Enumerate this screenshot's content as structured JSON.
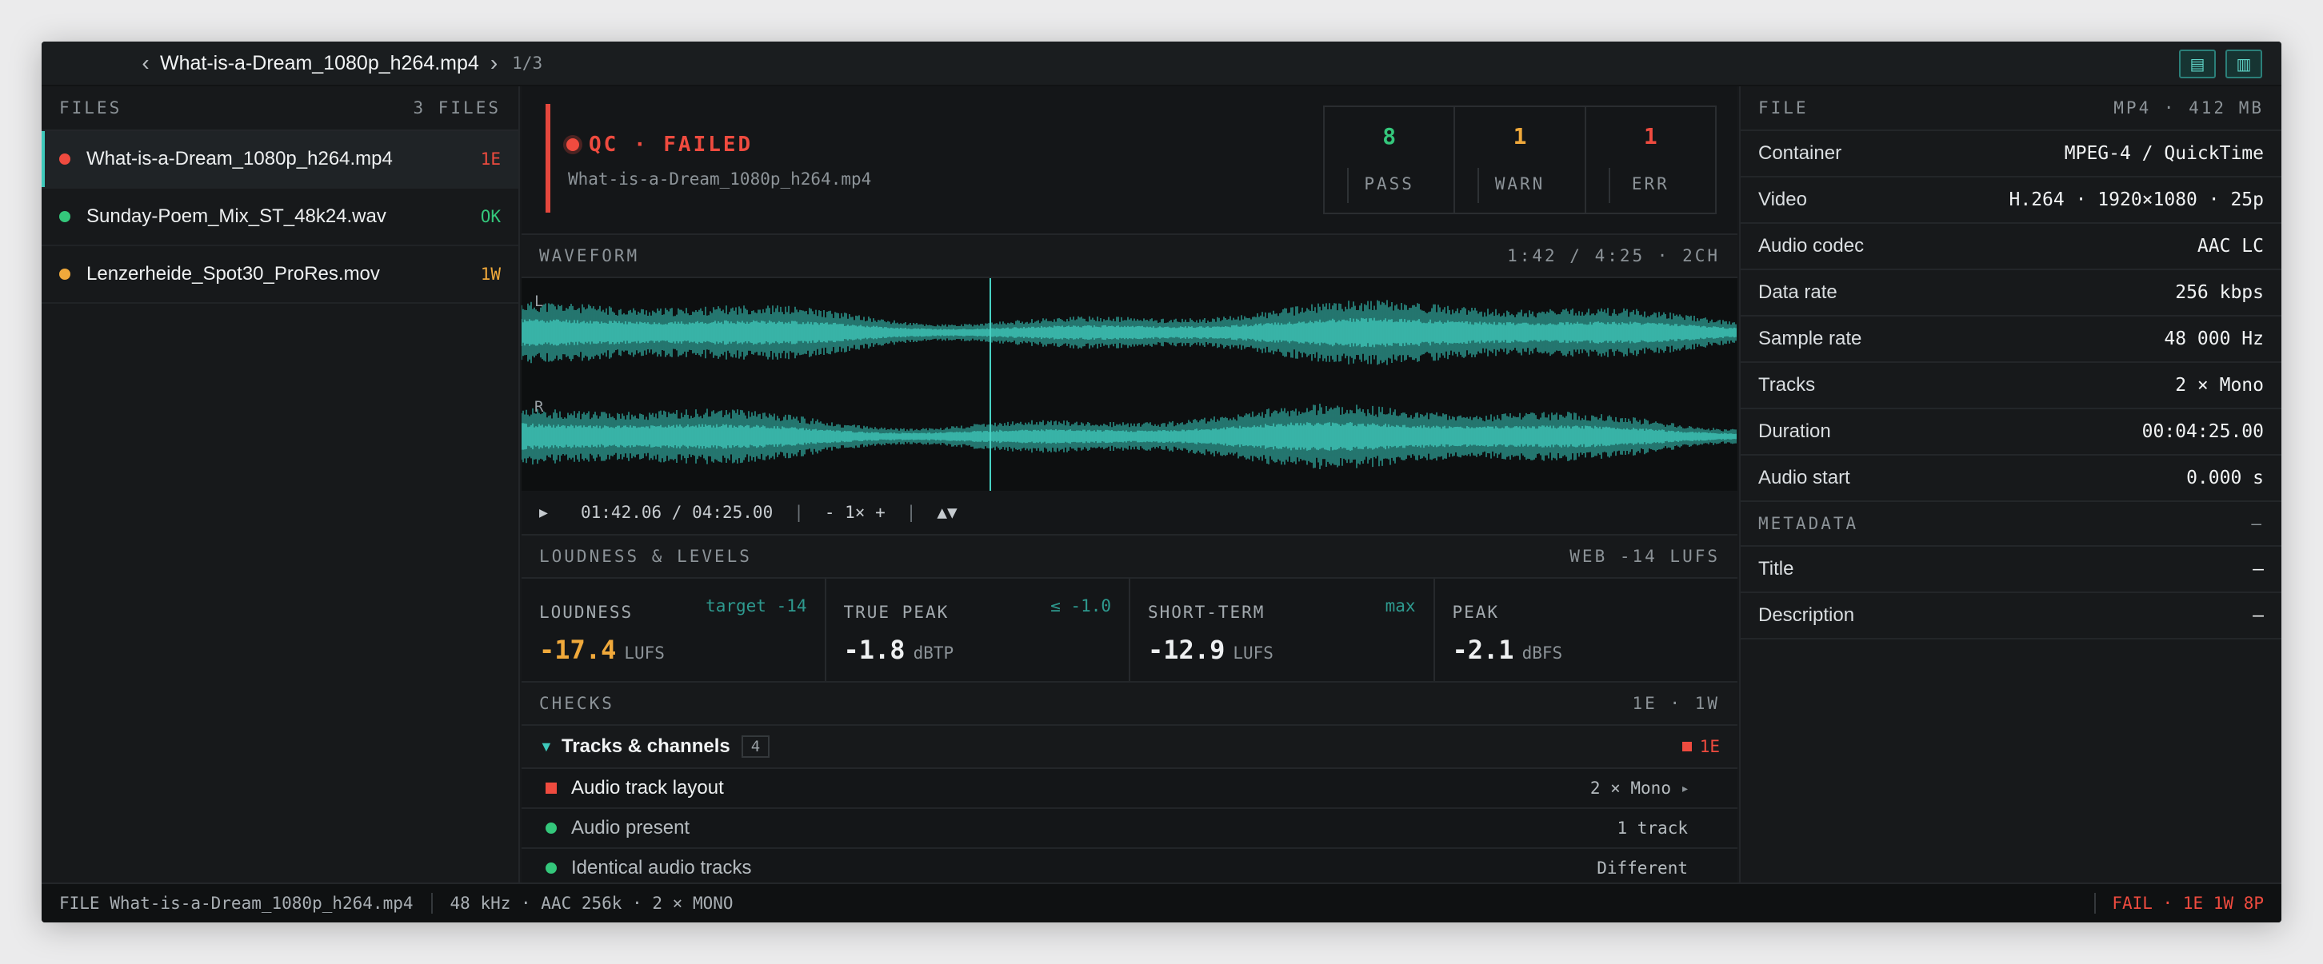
{
  "titlebar": {
    "prev_icon": "‹",
    "title": "What-is-a-Dream_1080p_h264.mp4",
    "next_icon": "›",
    "counter": "1/3",
    "view_icons": [
      "list-view-icon",
      "split-view-icon"
    ]
  },
  "files": {
    "header": "FILES",
    "count": "3 FILES",
    "items": [
      {
        "name": "What-is-a-Dream_1080p_h264.mp4",
        "badge": "1E",
        "status_color": "#ef4b3f",
        "active": true
      },
      {
        "name": "Sunday-Poem_Mix_ST_48k24.wav",
        "badge": "OK",
        "status_color": "#34c77b",
        "active": false
      },
      {
        "name": "Lenzerheide_Spot30_ProRes.mov",
        "badge": "1W",
        "status_color": "#f0a93b",
        "active": false
      }
    ]
  },
  "qc": {
    "status": "QC · FAILED",
    "file": "What-is-a-Dream_1080p_h264.mp4",
    "stats": [
      {
        "value": "8",
        "label": "PASS",
        "color": "#34c77b"
      },
      {
        "value": "1",
        "label": "WARN",
        "color": "#f0a93b"
      },
      {
        "value": "1",
        "label": "ERR",
        "color": "#ef4b3f"
      }
    ]
  },
  "waveform": {
    "title": "WAVEFORM",
    "info": "1:42 / 4:25 · 2CH",
    "channels": [
      "L",
      "R"
    ],
    "playhead_fraction": 0.3849,
    "color": "#3ec9bb"
  },
  "transport": {
    "play_icon": "▶",
    "time": "01:42.06 / 04:25.00",
    "zoom": "- 1× +",
    "sep": "|",
    "arrows": "▲▼"
  },
  "loudness": {
    "title": "LOUDNESS & LEVELS",
    "preset": "WEB -14 LUFS",
    "cells": [
      {
        "label": "LOUDNESS",
        "hint": "target -14",
        "value": "-17.4",
        "unit": "LUFS",
        "color": "#f0a93b"
      },
      {
        "label": "TRUE PEAK",
        "hint": "≤ -1.0",
        "value": "-1.8",
        "unit": "dBTP",
        "color": "#eef0f1"
      },
      {
        "label": "SHORT-TERM",
        "hint": "max",
        "value": "-12.9",
        "unit": "LUFS",
        "color": "#eef0f1"
      },
      {
        "label": "PEAK",
        "hint": "",
        "value": "-2.1",
        "unit": "dBFS",
        "color": "#eef0f1"
      }
    ]
  },
  "checks": {
    "title": "CHECKS",
    "summary": "1E · 1W",
    "group": {
      "name": "Tracks & channels",
      "count": "4",
      "badge": "1E"
    },
    "rows": [
      {
        "name": "Audio track layout",
        "value": "2 × Mono",
        "indicator": "square",
        "color": "#ef4b3f",
        "expand": "▸"
      },
      {
        "name": "Audio present",
        "value": "1 track",
        "indicator": "dot",
        "color": "#34c77b",
        "expand": ""
      },
      {
        "name": "Identical audio tracks",
        "value": "Different",
        "indicator": "dot",
        "color": "#34c77b",
        "expand": ""
      }
    ]
  },
  "file_info": {
    "header": "FILE",
    "meta": "MP4 · 412 MB",
    "props": [
      {
        "key": "Container",
        "value": "MPEG-4 / QuickTime"
      },
      {
        "key": "Video",
        "value": "H.264 · 1920×1080 · 25p"
      },
      {
        "key": "Audio codec",
        "value": "AAC LC"
      },
      {
        "key": "Data rate",
        "value": "256 kbps"
      },
      {
        "key": "Sample rate",
        "value": "48 000 Hz"
      },
      {
        "key": "Tracks",
        "value": "2 × Mono"
      },
      {
        "key": "Duration",
        "value": "00:04:25.00"
      },
      {
        "key": "Audio start",
        "value": "0.000 s"
      }
    ]
  },
  "metadata": {
    "header": "METADATA",
    "meta": "—",
    "props": [
      {
        "key": "Title",
        "value": "—"
      },
      {
        "key": "Description",
        "value": "—"
      }
    ]
  },
  "statusbar": {
    "file": "FILE What-is-a-Dream_1080p_h264.mp4",
    "audio": "48 kHz · AAC 256k · 2 × MONO",
    "result": "FAIL · 1E 1W 8P"
  }
}
